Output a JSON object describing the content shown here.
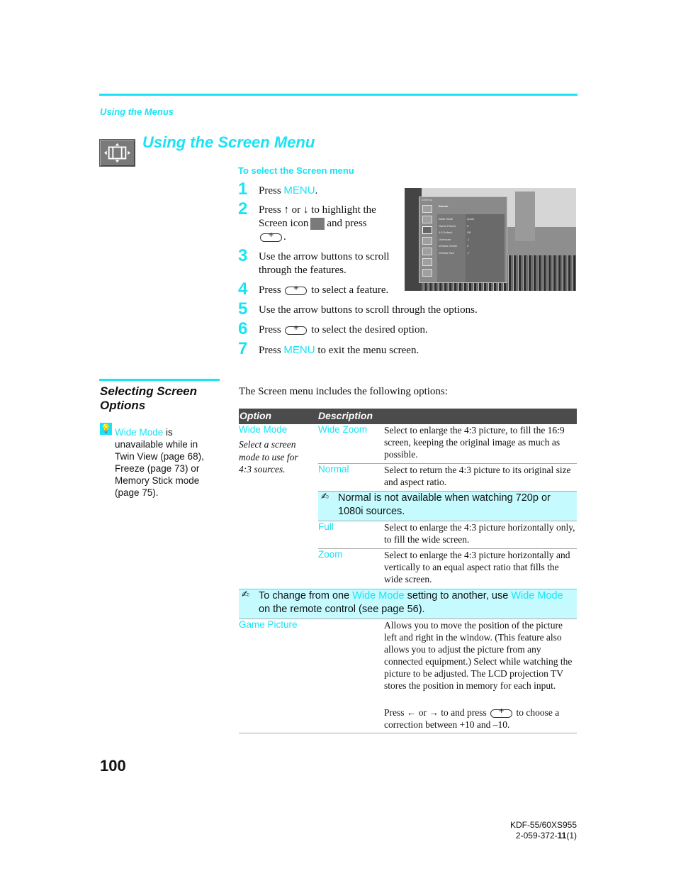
{
  "header": {
    "section_label": "Using the Menus",
    "page_title": "Using the Screen Menu",
    "icon": "screen-menu-icon"
  },
  "steps_section": {
    "subhead": "To select the Screen menu",
    "steps": [
      {
        "num": "1",
        "pre": "Press ",
        "key": "MENU",
        "post": "."
      },
      {
        "num": "2",
        "line1": "Press ↑ or ↓ to highlight the",
        "line2_pre": "Screen icon",
        "line2_post": "and press",
        "line3": "."
      },
      {
        "num": "3",
        "line1": "Use the arrow buttons to scroll",
        "line2": "through the features."
      },
      {
        "num": "4",
        "pre": "Press",
        "post": "to select a feature."
      },
      {
        "num": "5",
        "text": "Use the arrow buttons to scroll through the options."
      },
      {
        "num": "6",
        "pre": "Press",
        "post": "to select the desired option."
      },
      {
        "num": "7",
        "pre": "Press ",
        "key": "MENU",
        "post": " to exit the menu screen."
      }
    ]
  },
  "tv_menu": {
    "title": "Antenna",
    "screen_label": "Screen",
    "rows": [
      {
        "label": "Wide Mode",
        "value": "Zoom"
      },
      {
        "label": "Game Picture",
        "value": "0"
      },
      {
        "label": "4:3 Default",
        "value": "Off"
      },
      {
        "label": "Overscan",
        "value": "-1"
      },
      {
        "label": "Vertical Center",
        "value": "0"
      },
      {
        "label": "Vertical Size",
        "value": "-7"
      }
    ]
  },
  "sidebar": {
    "heading_line1": "Selecting Screen",
    "heading_line2": "Options",
    "tip_icon": "lightbulb-icon",
    "tip_link": "Wide Mode",
    "tip_text": " is unavailable while in Twin View (page 68), Freeze (page 73) or Memory Stick mode (page 75)."
  },
  "options": {
    "intro": "The Screen menu includes the following options:",
    "header": {
      "option": "Option",
      "description": "Description"
    },
    "wide_mode": {
      "name": "Wide Mode",
      "subtitle": "Select a screen mode to use for 4:3 sources.",
      "modes": [
        {
          "name": "Wide Zoom",
          "desc": "Select to enlarge the 4:3 picture, to fill the 16:9 screen, keeping the original image as much as possible."
        },
        {
          "name": "Normal",
          "desc": "Select to return the 4:3 picture to its original size and aspect ratio."
        },
        {
          "name": "Full",
          "desc": "Select to enlarge the 4:3 picture horizontally only, to fill the wide screen."
        },
        {
          "name": "Zoom",
          "desc": "Select to enlarge the 4:3 picture horizontally and vertically to an equal aspect ratio that fills the wide screen."
        }
      ],
      "normal_note": "Normal is not available when watching 720p or 1080i sources."
    },
    "wide_mode_note": {
      "pre": "To change from one ",
      "link1": "Wide Mode",
      "mid": " setting to another, use ",
      "link2": "Wide Mode",
      "post": " on the remote control (see page 56)."
    },
    "game_picture": {
      "name": "Game Picture",
      "desc": "Allows you to move the position of the picture left and right in the window. (This feature also allows you to adjust the picture from any connected equipment.) Select while watching the picture to be adjusted. The LCD projection TV stores the position in memory for each input.",
      "press_pre": "Press ← or → to and press",
      "press_post": "to choose a correction between +10 and –10."
    }
  },
  "footer": {
    "page_number": "100",
    "model": "KDF-55/60XS955",
    "doc_code_pre": "2-059-372-",
    "doc_code_bold": "11",
    "doc_code_post": "(1)"
  }
}
